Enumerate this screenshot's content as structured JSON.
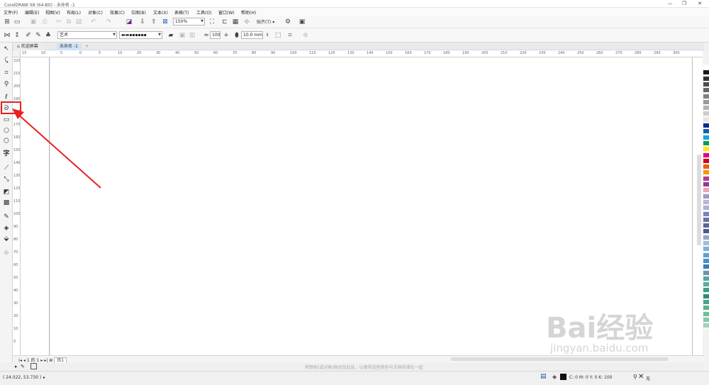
{
  "window": {
    "title": "CorelDRAW X8 (64-Bit) - 未命名 -1",
    "controls": [
      "—",
      "❐",
      "✕"
    ]
  },
  "menu": [
    {
      "label": "文件(F)"
    },
    {
      "label": "编辑(E)"
    },
    {
      "label": "视图(V)"
    },
    {
      "label": "布局(L)"
    },
    {
      "label": "对象(C)"
    },
    {
      "label": "效果(C)"
    },
    {
      "label": "位图(B)"
    },
    {
      "label": "文本(X)"
    },
    {
      "label": "表格(T)"
    },
    {
      "label": "工具(O)"
    },
    {
      "label": "窗口(W)"
    },
    {
      "label": "帮助(H)"
    }
  ],
  "standard_toolbar": {
    "zoom_value": "150%",
    "snap_label": "贴齐(T)"
  },
  "property_bar": {
    "style_preset": "艺术",
    "stroke_preset": "▬▬▪▪▪▪▪▪",
    "smoothing": "100",
    "stroke_width": "10.0 mm"
  },
  "tabs": [
    {
      "label": "欢迎屏幕",
      "icon": "home-icon"
    },
    {
      "label": "未命名 -1"
    }
  ],
  "ruler": {
    "h_ticks": [
      "15",
      "10",
      "5",
      "0",
      "5",
      "10",
      "20",
      "30",
      "40",
      "50",
      "60",
      "70",
      "80",
      "90",
      "100",
      "110",
      "120",
      "130",
      "140",
      "150",
      "160",
      "170",
      "180",
      "190",
      "200",
      "210",
      "220",
      "230",
      "240",
      "250",
      "260",
      "270",
      "280",
      "290",
      "300"
    ],
    "v_ticks": [
      "220",
      "210",
      "200",
      "190",
      "180",
      "170",
      "160",
      "150",
      "140",
      "130",
      "120",
      "110",
      "100",
      "90",
      "80",
      "70",
      "60",
      "50",
      "40",
      "30",
      "20",
      "10",
      "0"
    ]
  },
  "page_navigator": {
    "current": "1",
    "of_label": "的",
    "total": "1",
    "page_tab": "页1"
  },
  "hint": "将颜色(或对象)拖动至此处，以便将这些颜色与文档存储在一起",
  "status": {
    "coords": "( 24.022, 53.730 )",
    "fill": "C: 0 M: 0 Y: 0 K: 100",
    "outline": "无"
  },
  "palette": [
    "#ffffff",
    "#1a1a1a",
    "#333333",
    "#4d4d4d",
    "#666666",
    "#808080",
    "#999999",
    "#b3b3b3",
    "#cccccc",
    "#e6e6e6",
    "#0b2a8a",
    "#1f5bb5",
    "#15a6d8",
    "#0a9b52",
    "#ffe800",
    "#e6007e",
    "#d6001c",
    "#e85d10",
    "#f39a00",
    "#b63a8e",
    "#8a3c98",
    "#f4a0b6",
    "#9b99cc",
    "#c3b2d6",
    "#a8b4d8",
    "#7c83b8",
    "#6572a8",
    "#5b6595",
    "#4f5a8a",
    "#95a3c6",
    "#a2bedd",
    "#7fb2d9",
    "#5da3d1",
    "#4493c6",
    "#3a7db6",
    "#6d94a8",
    "#5fa3a3",
    "#55b09a",
    "#3e9d8a",
    "#2e8b7a",
    "#4aa38a",
    "#5ab08f",
    "#6fbc9a",
    "#84c8a8",
    "#9fd3b7"
  ],
  "watermark": {
    "brand": "Bai经验",
    "url": "jingyan.baidu.com"
  }
}
